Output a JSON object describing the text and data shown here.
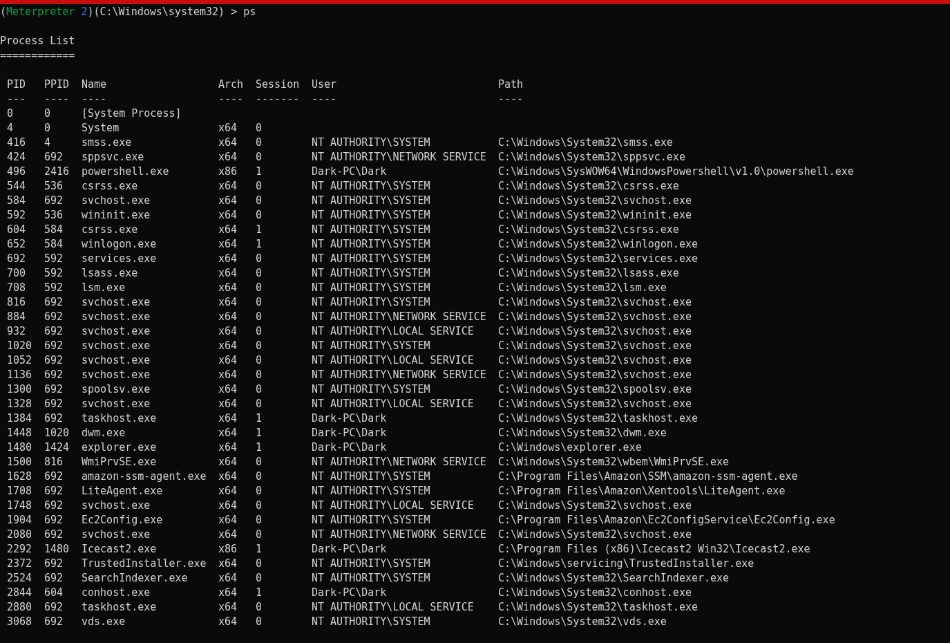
{
  "prompt": [
    {
      "text": "(",
      "kind": "plain"
    },
    {
      "text": "Meterpreter ",
      "kind": "session"
    },
    {
      "text": "2",
      "kind": "number"
    },
    {
      "text": ")(C:\\Windows\\system32) > ps",
      "kind": "plain"
    }
  ],
  "heading": "Process List",
  "heading_rule": "============",
  "columns": [
    {
      "label": "PID",
      "rule": "---"
    },
    {
      "label": "PPID",
      "rule": "----"
    },
    {
      "label": "Name",
      "rule": "----"
    },
    {
      "label": "Arch",
      "rule": "----"
    },
    {
      "label": "Session",
      "rule": "-------"
    },
    {
      "label": "User",
      "rule": "----"
    },
    {
      "label": "Path",
      "rule": "----"
    }
  ],
  "rows": [
    {
      "pid": "0",
      "ppid": "0",
      "name": "[System Process]"
    },
    {
      "pid": "4",
      "ppid": "0",
      "name": "System",
      "arch": "x64",
      "session": "0"
    },
    {
      "pid": "416",
      "ppid": "4",
      "name": "smss.exe",
      "arch": "x64",
      "session": "0",
      "user": "NT AUTHORITY\\SYSTEM",
      "path": "C:\\Windows\\System32\\smss.exe"
    },
    {
      "pid": "424",
      "ppid": "692",
      "name": "sppsvc.exe",
      "arch": "x64",
      "session": "0",
      "user": "NT AUTHORITY\\NETWORK SERVICE",
      "path": "C:\\Windows\\System32\\sppsvc.exe"
    },
    {
      "pid": "496",
      "ppid": "2416",
      "name": "powershell.exe",
      "arch": "x86",
      "session": "1",
      "user": "Dark-PC\\Dark",
      "path": "C:\\Windows\\SysWOW64\\WindowsPowershell\\v1.0\\powershell.exe"
    },
    {
      "pid": "544",
      "ppid": "536",
      "name": "csrss.exe",
      "arch": "x64",
      "session": "0",
      "user": "NT AUTHORITY\\SYSTEM",
      "path": "C:\\Windows\\System32\\csrss.exe"
    },
    {
      "pid": "584",
      "ppid": "692",
      "name": "svchost.exe",
      "arch": "x64",
      "session": "0",
      "user": "NT AUTHORITY\\SYSTEM",
      "path": "C:\\Windows\\System32\\svchost.exe"
    },
    {
      "pid": "592",
      "ppid": "536",
      "name": "wininit.exe",
      "arch": "x64",
      "session": "0",
      "user": "NT AUTHORITY\\SYSTEM",
      "path": "C:\\Windows\\System32\\wininit.exe"
    },
    {
      "pid": "604",
      "ppid": "584",
      "name": "csrss.exe",
      "arch": "x64",
      "session": "1",
      "user": "NT AUTHORITY\\SYSTEM",
      "path": "C:\\Windows\\System32\\csrss.exe"
    },
    {
      "pid": "652",
      "ppid": "584",
      "name": "winlogon.exe",
      "arch": "x64",
      "session": "1",
      "user": "NT AUTHORITY\\SYSTEM",
      "path": "C:\\Windows\\System32\\winlogon.exe"
    },
    {
      "pid": "692",
      "ppid": "592",
      "name": "services.exe",
      "arch": "x64",
      "session": "0",
      "user": "NT AUTHORITY\\SYSTEM",
      "path": "C:\\Windows\\System32\\services.exe"
    },
    {
      "pid": "700",
      "ppid": "592",
      "name": "lsass.exe",
      "arch": "x64",
      "session": "0",
      "user": "NT AUTHORITY\\SYSTEM",
      "path": "C:\\Windows\\System32\\lsass.exe"
    },
    {
      "pid": "708",
      "ppid": "592",
      "name": "lsm.exe",
      "arch": "x64",
      "session": "0",
      "user": "NT AUTHORITY\\SYSTEM",
      "path": "C:\\Windows\\System32\\lsm.exe"
    },
    {
      "pid": "816",
      "ppid": "692",
      "name": "svchost.exe",
      "arch": "x64",
      "session": "0",
      "user": "NT AUTHORITY\\SYSTEM",
      "path": "C:\\Windows\\System32\\svchost.exe"
    },
    {
      "pid": "884",
      "ppid": "692",
      "name": "svchost.exe",
      "arch": "x64",
      "session": "0",
      "user": "NT AUTHORITY\\NETWORK SERVICE",
      "path": "C:\\Windows\\System32\\svchost.exe"
    },
    {
      "pid": "932",
      "ppid": "692",
      "name": "svchost.exe",
      "arch": "x64",
      "session": "0",
      "user": "NT AUTHORITY\\LOCAL SERVICE",
      "path": "C:\\Windows\\System32\\svchost.exe"
    },
    {
      "pid": "1020",
      "ppid": "692",
      "name": "svchost.exe",
      "arch": "x64",
      "session": "0",
      "user": "NT AUTHORITY\\SYSTEM",
      "path": "C:\\Windows\\System32\\svchost.exe"
    },
    {
      "pid": "1052",
      "ppid": "692",
      "name": "svchost.exe",
      "arch": "x64",
      "session": "0",
      "user": "NT AUTHORITY\\LOCAL SERVICE",
      "path": "C:\\Windows\\System32\\svchost.exe"
    },
    {
      "pid": "1136",
      "ppid": "692",
      "name": "svchost.exe",
      "arch": "x64",
      "session": "0",
      "user": "NT AUTHORITY\\NETWORK SERVICE",
      "path": "C:\\Windows\\System32\\svchost.exe"
    },
    {
      "pid": "1300",
      "ppid": "692",
      "name": "spoolsv.exe",
      "arch": "x64",
      "session": "0",
      "user": "NT AUTHORITY\\SYSTEM",
      "path": "C:\\Windows\\System32\\spoolsv.exe"
    },
    {
      "pid": "1328",
      "ppid": "692",
      "name": "svchost.exe",
      "arch": "x64",
      "session": "0",
      "user": "NT AUTHORITY\\LOCAL SERVICE",
      "path": "C:\\Windows\\System32\\svchost.exe"
    },
    {
      "pid": "1384",
      "ppid": "692",
      "name": "taskhost.exe",
      "arch": "x64",
      "session": "1",
      "user": "Dark-PC\\Dark",
      "path": "C:\\Windows\\System32\\taskhost.exe"
    },
    {
      "pid": "1448",
      "ppid": "1020",
      "name": "dwm.exe",
      "arch": "x64",
      "session": "1",
      "user": "Dark-PC\\Dark",
      "path": "C:\\Windows\\System32\\dwm.exe"
    },
    {
      "pid": "1480",
      "ppid": "1424",
      "name": "explorer.exe",
      "arch": "x64",
      "session": "1",
      "user": "Dark-PC\\Dark",
      "path": "C:\\Windows\\explorer.exe"
    },
    {
      "pid": "1500",
      "ppid": "816",
      "name": "WmiPrvSE.exe",
      "arch": "x64",
      "session": "0",
      "user": "NT AUTHORITY\\NETWORK SERVICE",
      "path": "C:\\Windows\\System32\\wbem\\WmiPrvSE.exe"
    },
    {
      "pid": "1628",
      "ppid": "692",
      "name": "amazon-ssm-agent.exe",
      "arch": "x64",
      "session": "0",
      "user": "NT AUTHORITY\\SYSTEM",
      "path": "C:\\Program Files\\Amazon\\SSM\\amazon-ssm-agent.exe"
    },
    {
      "pid": "1708",
      "ppid": "692",
      "name": "LiteAgent.exe",
      "arch": "x64",
      "session": "0",
      "user": "NT AUTHORITY\\SYSTEM",
      "path": "C:\\Program Files\\Amazon\\Xentools\\LiteAgent.exe"
    },
    {
      "pid": "1748",
      "ppid": "692",
      "name": "svchost.exe",
      "arch": "x64",
      "session": "0",
      "user": "NT AUTHORITY\\LOCAL SERVICE",
      "path": "C:\\Windows\\System32\\svchost.exe"
    },
    {
      "pid": "1904",
      "ppid": "692",
      "name": "Ec2Config.exe",
      "arch": "x64",
      "session": "0",
      "user": "NT AUTHORITY\\SYSTEM",
      "path": "C:\\Program Files\\Amazon\\Ec2ConfigService\\Ec2Config.exe"
    },
    {
      "pid": "2080",
      "ppid": "692",
      "name": "svchost.exe",
      "arch": "x64",
      "session": "0",
      "user": "NT AUTHORITY\\NETWORK SERVICE",
      "path": "C:\\Windows\\System32\\svchost.exe"
    },
    {
      "pid": "2292",
      "ppid": "1480",
      "name": "Icecast2.exe",
      "arch": "x86",
      "session": "1",
      "user": "Dark-PC\\Dark",
      "path": "C:\\Program Files (x86)\\Icecast2 Win32\\Icecast2.exe"
    },
    {
      "pid": "2372",
      "ppid": "692",
      "name": "TrustedInstaller.exe",
      "arch": "x64",
      "session": "0",
      "user": "NT AUTHORITY\\SYSTEM",
      "path": "C:\\Windows\\servicing\\TrustedInstaller.exe"
    },
    {
      "pid": "2524",
      "ppid": "692",
      "name": "SearchIndexer.exe",
      "arch": "x64",
      "session": "0",
      "user": "NT AUTHORITY\\SYSTEM",
      "path": "C:\\Windows\\System32\\SearchIndexer.exe"
    },
    {
      "pid": "2844",
      "ppid": "604",
      "name": "conhost.exe",
      "arch": "x64",
      "session": "1",
      "user": "Dark-PC\\Dark",
      "path": "C:\\Windows\\System32\\conhost.exe"
    },
    {
      "pid": "2880",
      "ppid": "692",
      "name": "taskhost.exe",
      "arch": "x64",
      "session": "0",
      "user": "NT AUTHORITY\\LOCAL SERVICE",
      "path": "C:\\Windows\\System32\\taskhost.exe"
    },
    {
      "pid": "3068",
      "ppid": "692",
      "name": "vds.exe",
      "arch": "x64",
      "session": "0",
      "user": "NT AUTHORITY\\SYSTEM",
      "path": "C:\\Windows\\System32\\vds.exe"
    }
  ]
}
